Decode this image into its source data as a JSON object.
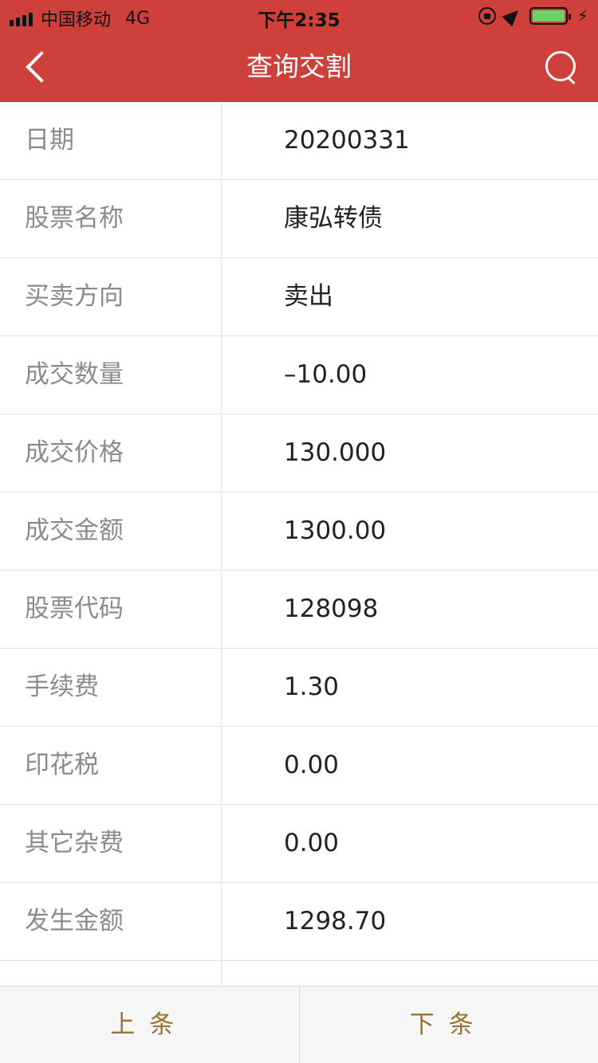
{
  "status_bar": {
    "carrier": "中国移动",
    "network": "4G",
    "time": "下午2:35"
  },
  "navbar": {
    "title": "查询交割",
    "back_icon": "chevron-left-icon",
    "search_icon": "search-icon"
  },
  "rows": [
    {
      "label": "日期",
      "value": "20200331"
    },
    {
      "label": "股票名称",
      "value": "康弘转债"
    },
    {
      "label": "买卖方向",
      "value": "卖出"
    },
    {
      "label": "成交数量",
      "value": "–10.00"
    },
    {
      "label": "成交价格",
      "value": "130.000"
    },
    {
      "label": "成交金额",
      "value": "1300.00"
    },
    {
      "label": "股票代码",
      "value": "128098"
    },
    {
      "label": "手续费",
      "value": "1.30"
    },
    {
      "label": "印花税",
      "value": "0.00"
    },
    {
      "label": "其它杂费",
      "value": "0.00"
    },
    {
      "label": "发生金额",
      "value": "1298.70"
    }
  ],
  "bottom_bar": {
    "prev_label": "上条",
    "next_label": "下条"
  },
  "colors": {
    "header": "#d0403a",
    "label_text": "#8b8b8b",
    "value_text": "#222222",
    "button_text": "#9c7233"
  }
}
